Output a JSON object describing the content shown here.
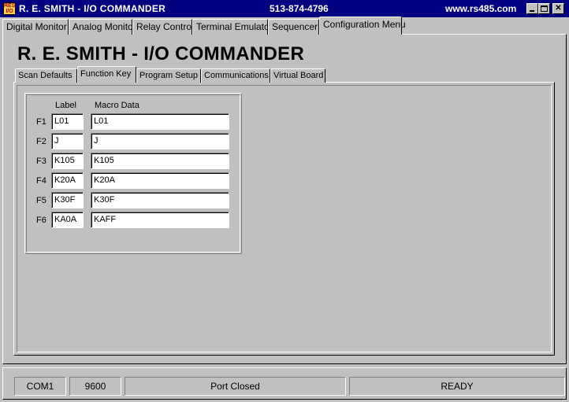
{
  "window": {
    "title": "R. E. SMITH -  I/O COMMANDER",
    "phone": "513-874-4796",
    "url": "www.rs485.com",
    "icon_name": "app-logo-icon"
  },
  "top_tabs": [
    {
      "label": "Digital Monitor",
      "active": false
    },
    {
      "label": "Analog Monitor",
      "active": false
    },
    {
      "label": "Relay Control",
      "active": false
    },
    {
      "label": "Terminal Emulator",
      "active": false
    },
    {
      "label": "Sequencer",
      "active": false
    },
    {
      "label": "Configuration Menu",
      "active": true
    }
  ],
  "heading": "R. E. SMITH - I/O COMMANDER",
  "inner_tabs": [
    {
      "label": "Scan Defaults",
      "active": false
    },
    {
      "label": "Function Key",
      "active": true
    },
    {
      "label": "Program Setup",
      "active": false
    },
    {
      "label": "Communications",
      "active": false
    },
    {
      "label": "Virtual Board",
      "active": false
    }
  ],
  "function_keys": {
    "label_header": "Label",
    "macro_header": "Macro Data",
    "rows": [
      {
        "key": "F1",
        "label": "L01",
        "macro": "L01"
      },
      {
        "key": "F2",
        "label": "J",
        "macro": "J"
      },
      {
        "key": "F3",
        "label": "K105",
        "macro": "K105"
      },
      {
        "key": "F4",
        "label": "K20A",
        "macro": "K20A"
      },
      {
        "key": "F5",
        "label": "K30F",
        "macro": "K30F"
      },
      {
        "key": "F6",
        "label": "KA0A",
        "macro": "KAFF"
      }
    ]
  },
  "status": {
    "port": "COM1",
    "baud": "9600",
    "port_state": "Port Closed",
    "state": "READY"
  },
  "colors": {
    "titlebar": "#000080",
    "face": "#c0c0c0"
  }
}
